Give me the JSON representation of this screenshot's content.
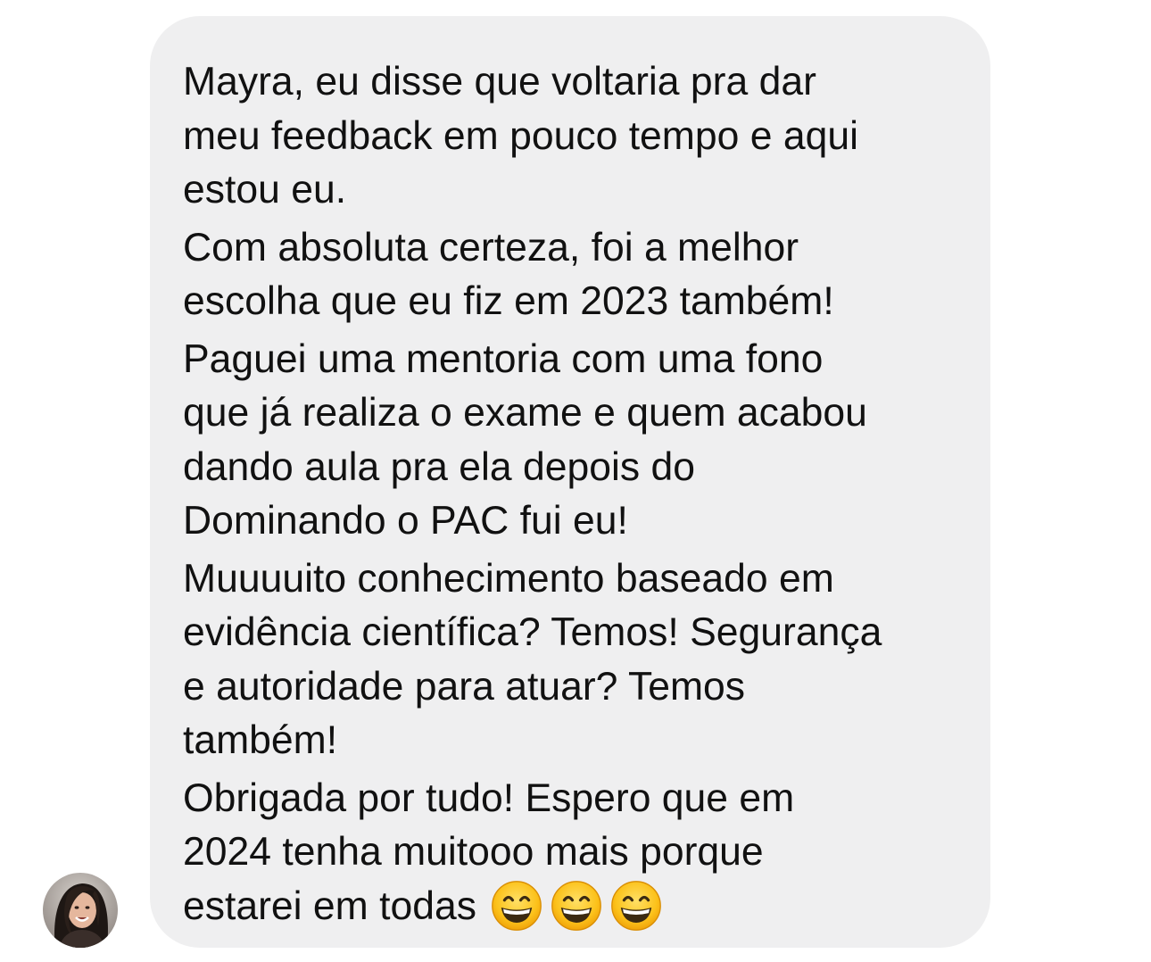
{
  "message": {
    "paragraphs": [
      {
        "lines": [
          "Mayra, eu disse que voltaria pra dar",
          "meu feedback em pouco tempo e aqui",
          "estou eu."
        ]
      },
      {
        "lines": [
          "Com absoluta certeza, foi a melhor",
          "escolha que eu fiz em 2023 também!"
        ]
      },
      {
        "lines": [
          "Paguei uma mentoria com uma fono",
          "que já realiza o exame e quem acabou",
          "dando aula pra ela depois do",
          "Dominando o PAC fui eu!"
        ]
      },
      {
        "lines": [
          "Muuuuito conhecimento baseado em",
          "evidência científica? Temos! Segurança",
          "e autoridade para atuar? Temos",
          "também!"
        ]
      },
      {
        "lines": [
          "Obrigada por tudo! Espero que em",
          "2024 tenha muitooo mais porque",
          "estarei em todas"
        ]
      }
    ],
    "trailing_emojis": [
      "grinning-face-with-smiling-eyes-emoji",
      "grinning-face-with-smiling-eyes-emoji",
      "grinning-face-with-smiling-eyes-emoji"
    ]
  },
  "sender": {
    "avatar_icon": "profile-photo"
  },
  "colors": {
    "bubble_bg": "#efeff0",
    "text": "#111111",
    "emoji_yellow": "#fcc21b"
  }
}
